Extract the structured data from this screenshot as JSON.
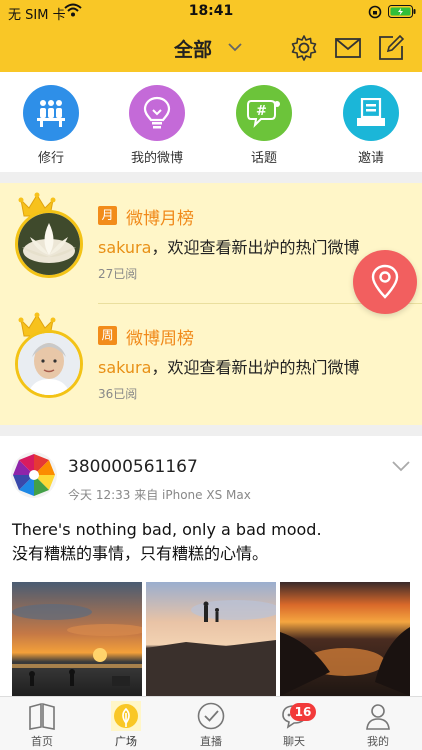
{
  "status_bar": {
    "carrier": "无 SIM 卡",
    "time": "18:41"
  },
  "nav": {
    "title": "全部",
    "icons": [
      "settings-gear-icon",
      "mail-envelope-icon",
      "compose-edit-icon"
    ],
    "accent": "#f9c726"
  },
  "quick_actions": [
    {
      "label": "修行",
      "icon": "people-group-icon",
      "color": "#2e8fe8"
    },
    {
      "label": "我的微博",
      "icon": "lightbulb-icon",
      "color": "#c46ad8"
    },
    {
      "label": "话题",
      "icon": "hashtag-chat-icon",
      "color": "#6cc43a"
    },
    {
      "label": "邀请",
      "icon": "invite-card-icon",
      "color": "#1bb6d8"
    }
  ],
  "rankings": [
    {
      "tag": "月",
      "title": "微博月榜",
      "user": "sakura",
      "message": "，欢迎查看新出炉的热门微博",
      "reads": "27已阅"
    },
    {
      "tag": "周",
      "title": "微博周榜",
      "user": "sakura",
      "message": "，欢迎查看新出炉的热门微博",
      "reads": "36已阅"
    }
  ],
  "post": {
    "username": "380000561167",
    "meta": "今天 12:33 来自 iPhone XS Max",
    "text_line1": "There's nothing bad, only a bad mood.",
    "text_line2": "没有糟糕的事情，只有糟糕的心情。"
  },
  "tabs": [
    {
      "label": "首页",
      "icon": "book-icon"
    },
    {
      "label": "广场",
      "icon": "plaza-leaf-icon",
      "active": true
    },
    {
      "label": "直播",
      "icon": "check-circle-icon"
    },
    {
      "label": "聊天",
      "icon": "chat-bubble-icon",
      "badge": "16"
    },
    {
      "label": "我的",
      "icon": "person-icon"
    }
  ]
}
